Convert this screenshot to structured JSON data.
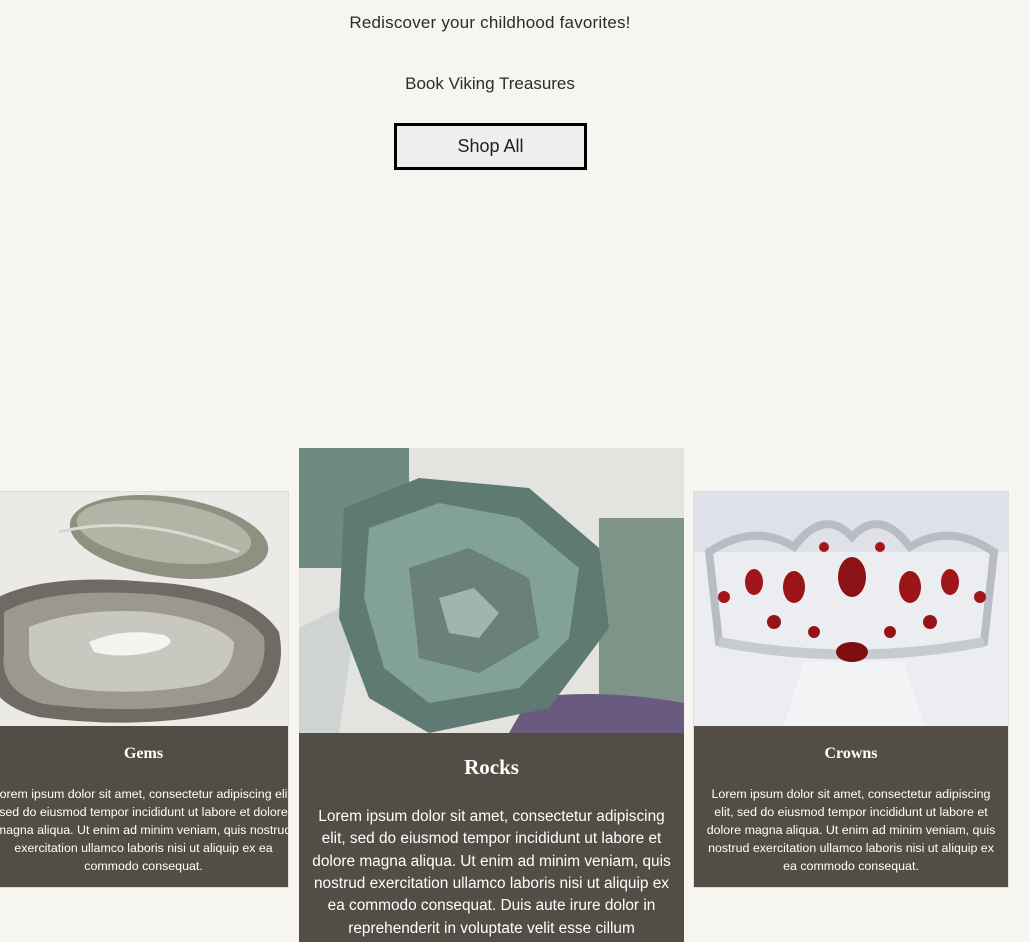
{
  "hero": {
    "tagline": "Rediscover your childhood favorites!",
    "subtitle": "Book Viking Treasures",
    "shop_all_label": "Shop All"
  },
  "cards": [
    {
      "title": "Gems",
      "image_icon": "agate-slices-image",
      "body": "Lorem ipsum dolor sit amet, consectetur adipiscing elit, sed do eiusmod tempor incididunt ut labore et dolore magna aliqua. Ut enim ad minim veniam, quis nostrud exercitation ullamco laboris nisi ut aliquip ex ea commodo consequat."
    },
    {
      "title": "Rocks",
      "image_icon": "rough-mineral-image",
      "body": "Lorem ipsum dolor sit amet, consectetur adipiscing elit, sed do eiusmod tempor incididunt ut labore et dolore magna aliqua. Ut enim ad minim veniam, quis nostrud exercitation ullamco laboris nisi ut aliquip ex ea commodo consequat. Duis aute irure dolor in reprehenderit in voluptate velit esse cillum"
    },
    {
      "title": "Crowns",
      "image_icon": "jeweled-crown-image",
      "body": "Lorem ipsum dolor sit amet, consectetur adipiscing elit, sed do eiusmod tempor incididunt ut labore et dolore magna aliqua. Ut enim ad minim veniam, quis nostrud exercitation ullamco laboris nisi ut aliquip ex ea commodo consequat."
    }
  ],
  "colors": {
    "page_background": "#f7f5f0",
    "card_panel": "#524d45",
    "button_border": "#000000",
    "button_fill": "#efeff0"
  }
}
